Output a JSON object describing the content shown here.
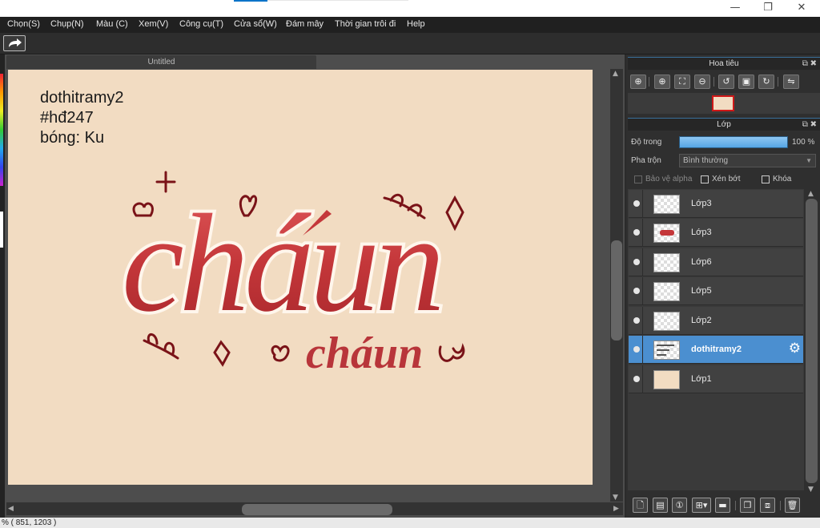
{
  "window": {
    "minimize": "—",
    "restore": "❐",
    "close": "✕"
  },
  "menu": [
    "Chọn(S)",
    "Chụp(N)",
    "Màu (C)",
    "Xem(V)",
    "Công cụ(T)",
    "Cửa sổ(W)",
    "Đám mây",
    "Thời gian trôi đi",
    "Help"
  ],
  "document": {
    "tab_title": "Untitled",
    "canvas_text": [
      "dothitramy2",
      "#hđ247",
      "bóng: Ku"
    ],
    "artwork_main_word": "cháun",
    "artwork_sub_word": "cháun",
    "canvas_color": "#f2dcc2",
    "lettering_color": "#c0383c"
  },
  "navigator": {
    "title": "Hoa tiêu",
    "buttons": [
      "zoom-fit",
      "zoom-in",
      "fit-window",
      "zoom-out",
      "rotate-left",
      "fullscreen",
      "rotate-right",
      "flip"
    ]
  },
  "layers_panel": {
    "title": "Lớp",
    "opacity_label": "Độ trong",
    "opacity_value": "100 %",
    "opacity_fraction": 1.0,
    "blend_label": "Pha trộn",
    "blend_value": "Bình thường",
    "protect_alpha": "Bảo vệ alpha",
    "clipping": "Xén bớt",
    "lock": "Khóa",
    "layers": [
      {
        "name": "Lớp3",
        "active": false
      },
      {
        "name": "Lớp3",
        "active": false
      },
      {
        "name": "Lớp6",
        "active": false
      },
      {
        "name": "Lớp5",
        "active": false
      },
      {
        "name": "Lớp2",
        "active": false
      },
      {
        "name": "dothitramy2",
        "active": true
      },
      {
        "name": "Lớp1",
        "active": false
      }
    ]
  },
  "status": {
    "text": "%  ( 851, 1203 )"
  },
  "colors": {
    "accent": "#4b8fd0"
  }
}
